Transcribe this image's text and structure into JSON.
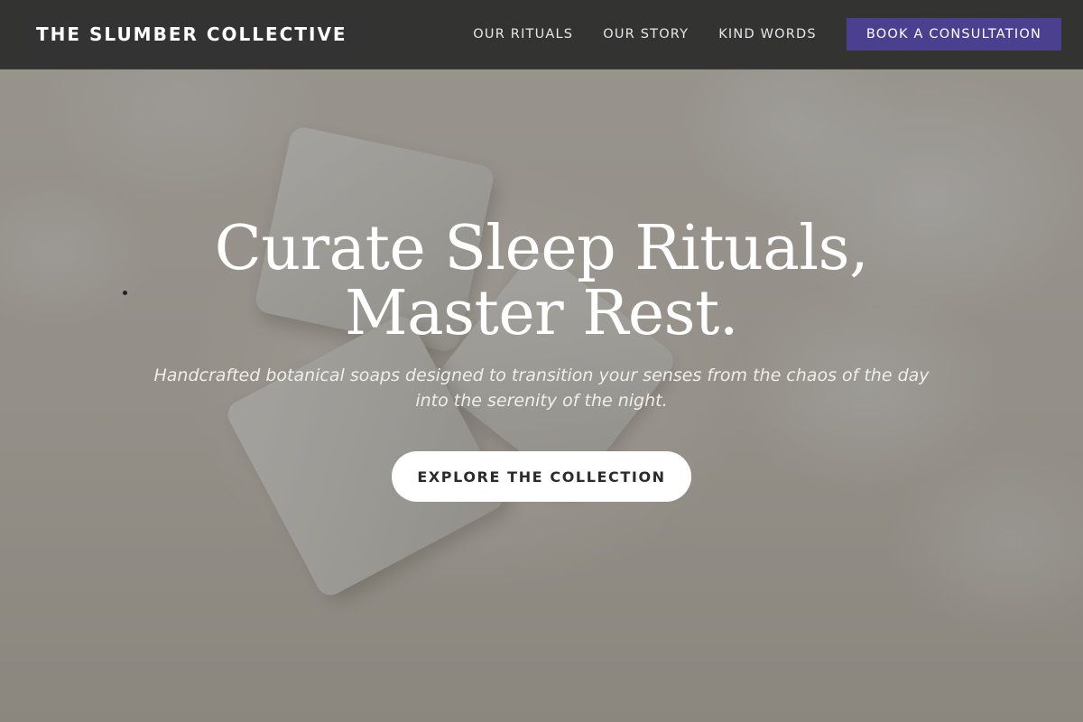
{
  "brand": {
    "name": "THE SLUMBER COLLECTIVE"
  },
  "nav": {
    "links": [
      {
        "label": "OUR RITUALS"
      },
      {
        "label": "OUR STORY"
      },
      {
        "label": "KIND WORDS"
      }
    ],
    "cta_label": "BOOK A CONSULTATION"
  },
  "hero": {
    "title_line_1": "Curate Sleep Rituals,",
    "title_line_2": "Master Rest.",
    "subtitle": "Handcrafted botanical soaps designed to transition your senses from the chaos of the day into the serenity of the night.",
    "button_label": "EXPLORE THE COLLECTION"
  },
  "colors": {
    "nav_background": "#2a2a2a",
    "accent": "#4b3f8f",
    "hero_button_background": "#ffffff",
    "hero_text": "#ffffff"
  }
}
